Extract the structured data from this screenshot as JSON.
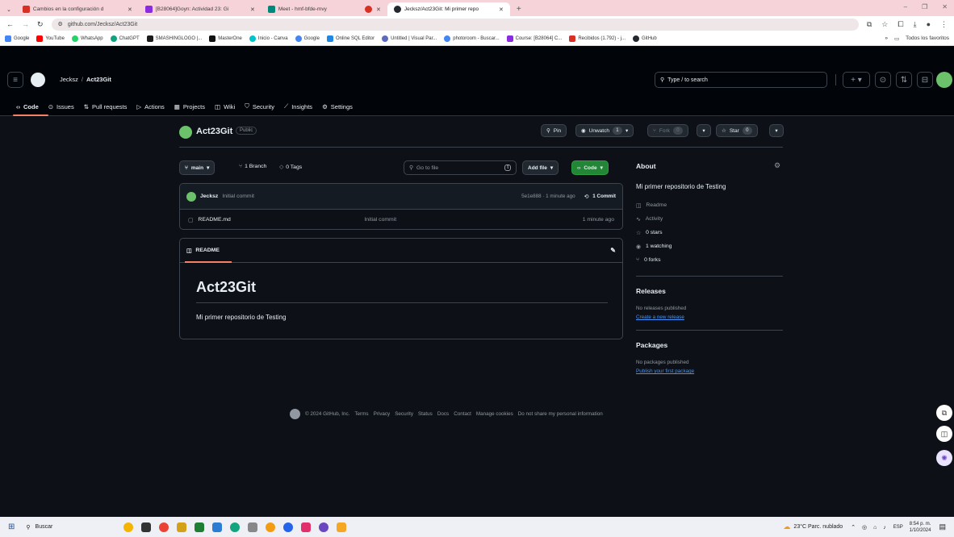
{
  "browser": {
    "tabs": [
      {
        "title": "Cambios en la configuración d",
        "color": "#d93025"
      },
      {
        "title": "[B28064]Goyn: Actividad 23: Gi",
        "color": "#8a2be2"
      },
      {
        "title": "Meet - hmf-bfde-mvy",
        "color": "#00897b"
      },
      {
        "title": "",
        "color": "#d93025"
      },
      {
        "title": "Jecksz/Act23Git: Mi primer repo",
        "color": "#24292f"
      }
    ],
    "url": "github.com/Jecksz/Act23Git",
    "bookmarks": [
      "Google",
      "YouTube",
      "WhatsApp",
      "ChatGPT",
      "SMASHINGLOGO |...",
      "MasterOne",
      "Inicio - Canva",
      "Google",
      "Online SQL Editor",
      "Untitled | Visual Par...",
      "photoroom - Buscar...",
      "Course: [B28064] C...",
      "Recibidos (1.792) - j...",
      "GitHub"
    ],
    "bookmark_colors": [
      "#4285f4",
      "#ff0000",
      "#25d366",
      "#10a37f",
      "#1b1b1b",
      "#111111",
      "#00c4cc",
      "#4285f4",
      "#1e88e5",
      "#5c6bc0",
      "#4285f4",
      "#8a2be2",
      "#d93025",
      "#24292f"
    ],
    "all_bookmarks": "Todos los favoritos"
  },
  "header": {
    "owner": "Jecksz",
    "separator": "/",
    "repo": "Act23Git",
    "search_placeholder": "Type / to search"
  },
  "nav": [
    {
      "label": "Code",
      "icon": "code-icon"
    },
    {
      "label": "Issues",
      "icon": "issue-icon"
    },
    {
      "label": "Pull requests",
      "icon": "pull-request-icon"
    },
    {
      "label": "Actions",
      "icon": "play-icon"
    },
    {
      "label": "Projects",
      "icon": "table-icon"
    },
    {
      "label": "Wiki",
      "icon": "book-icon"
    },
    {
      "label": "Security",
      "icon": "shield-icon"
    },
    {
      "label": "Insights",
      "icon": "graph-icon"
    },
    {
      "label": "Settings",
      "icon": "gear-icon"
    }
  ],
  "repo": {
    "name": "Act23Git",
    "visibility": "Public",
    "pin": "Pin",
    "unwatch": "Unwatch",
    "watch_count": "1",
    "fork": "Fork",
    "fork_count": "0",
    "star": "Star",
    "star_count": "0"
  },
  "files_bar": {
    "branch": "main",
    "branches": "1 Branch",
    "tags": "0 Tags",
    "goto_placeholder": "Go to file",
    "goto_key": "t",
    "add_file": "Add file",
    "code": "Code"
  },
  "commit": {
    "author": "Jecksz",
    "message": "Initial commit",
    "hash_time": "5e1e888 · 1 minute ago",
    "commits": "1 Commit"
  },
  "files": [
    {
      "name": "README.md",
      "message": "Initial commit",
      "time": "1 minute ago"
    }
  ],
  "readme": {
    "tab": "README",
    "title": "Act23Git",
    "body": "Mi primer repositorio de Testing"
  },
  "about": {
    "heading": "About",
    "description": "Mi primer repositorio de Testing",
    "items": [
      {
        "icon": "book-icon",
        "label": "Readme"
      },
      {
        "icon": "pulse-icon",
        "label": "Activity"
      },
      {
        "icon": "star-icon",
        "label": "0 stars"
      },
      {
        "icon": "eye-icon",
        "label": "1 watching"
      },
      {
        "icon": "fork-icon",
        "label": "0 forks"
      }
    ],
    "releases_heading": "Releases",
    "releases_none": "No releases published",
    "releases_link": "Create a new release",
    "packages_heading": "Packages",
    "packages_none": "No packages published",
    "packages_link": "Publish your first package"
  },
  "footer": {
    "copyright": "© 2024 GitHub, Inc.",
    "links": [
      "Terms",
      "Privacy",
      "Security",
      "Status",
      "Docs",
      "Contact",
      "Manage cookies",
      "Do not share my personal information"
    ]
  },
  "taskbar": {
    "search": "Buscar",
    "weather": "23°C Parc. nublado",
    "lang": "ESP",
    "time": "8:54 p. m.",
    "date": "1/10/2024",
    "app_colors": [
      "#f4b400",
      "#333333",
      "#ea4335",
      "#d4a017",
      "#1e7e34",
      "#2b7cd3",
      "#12a37f",
      "#888888",
      "#f39c12",
      "#2563eb",
      "#e1306c",
      "#6b46c1",
      "#f5a623"
    ]
  }
}
